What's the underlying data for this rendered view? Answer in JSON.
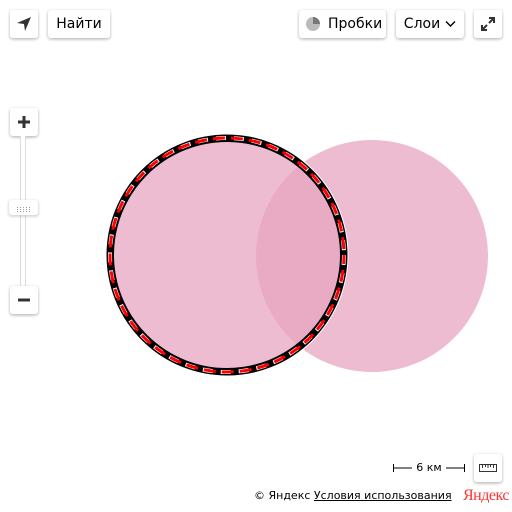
{
  "toolbar": {
    "geolocation_icon": "geolocation-arrow-icon",
    "find_label": "Найти",
    "traffic_label": "Пробки",
    "traffic_icon": "traffic-light-icon",
    "layers_label": "Слои",
    "layers_icon": "chevron-down-icon",
    "fullscreen_icon": "expand-icon"
  },
  "zoom": {
    "in_icon": "plus-icon",
    "out_icon": "minus-icon",
    "handle_icon": "grip-icon"
  },
  "map": {
    "circle_fill": "#e7a5c0",
    "selected_outline_colors": [
      "#000000",
      "#ff0000",
      "#ffffff"
    ],
    "shapes": [
      "circle-selected",
      "circle"
    ]
  },
  "scale": {
    "label": "6 км"
  },
  "ruler": {
    "icon": "ruler-icon"
  },
  "footer": {
    "copyright": "© Яндекс",
    "terms_link": "Условия использования",
    "logo": "Яндекс"
  }
}
